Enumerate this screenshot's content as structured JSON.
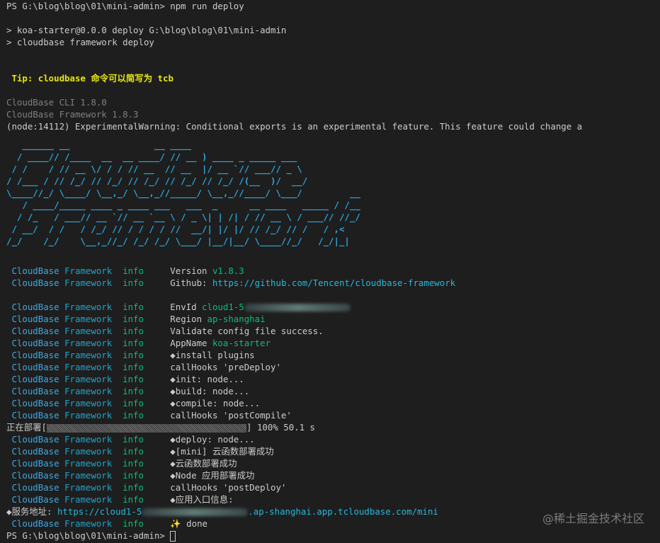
{
  "prompt": {
    "ps": "PS G:\\blog\\blog\\01\\mini-admin> ",
    "command": "npm run deploy"
  },
  "npm": {
    "line1": "> koa-starter@0.0.0 deploy G:\\blog\\blog\\01\\mini-admin",
    "line2": "> cloudbase framework deploy"
  },
  "tip": " Tip: cloudbase 命令可以简写为 tcb",
  "versions": {
    "cli": "CloudBase CLI 1.8.0",
    "framework": "CloudBase Framework 1.8.3"
  },
  "warning": "(node:14112) ExperimentalWarning: Conditional exports is an experimental feature. This feature could change a",
  "banner_lines": [
    "   ______ __                __ ____",
    "  / ____// /____  __  __ ____/ // __ ) ____ _ _____ ___",
    " / /    / // __ \\/ / / // __  // __  |/ __ `// ___// _ \\",
    "/ /___ / // /_/ // /_/ // /_/ // /_/ // /_/ /(__  )/  __/",
    "\\____//_/ \\____/ \\__,_/ \\__,_//_____/ \\__,_//____/ \\___/         __",
    "   / ____/_____ ____ _ ____ ___   ___  _      __ ____   _____ / /__",
    "  / /_   / ___// __ `// __ `__ \\ / _ \\| | /| / // __ \\ / ___// //_/",
    " / __/  / /   / /_/ // / / / / //  __/| |/ |/ // /_/ // /   / ,<",
    "/_/    /_/    \\__,_//_/ /_/ /_/ \\___/ |__/|__/ \\____//_/   /_/|_|"
  ],
  "brand": {
    "a": "CloudBase",
    "b": "Framework",
    "level": "info"
  },
  "logs": [
    {
      "label": "Version ",
      "value": "v1.8.3",
      "value_style": "g",
      "blur": 0
    },
    {
      "label": "Github: ",
      "value": "https://github.com/Tencent/cloudbase-framework",
      "value_style": "link",
      "blur": 0
    },
    null,
    {
      "label": "EnvId ",
      "value": "cloud1-5",
      "value_style": "g",
      "blur": 150
    },
    {
      "label": "Region ",
      "value": "ap-shanghai",
      "value_style": "g",
      "blur": 0
    },
    {
      "label": "Validate config file success.",
      "value": "",
      "value_style": "",
      "blur": 0
    },
    {
      "label": "AppName ",
      "value": "koa-starter",
      "value_style": "g",
      "blur": 0
    },
    {
      "label": "◆install plugins",
      "value": "",
      "value_style": "",
      "blur": 0
    },
    {
      "label": "callHooks 'preDeploy'",
      "value": "",
      "value_style": "",
      "blur": 0
    },
    {
      "label": "◆init: node...",
      "value": "",
      "value_style": "",
      "blur": 0
    },
    {
      "label": "◆build: node...",
      "value": "",
      "value_style": "",
      "blur": 0
    },
    {
      "label": "◆compile: node...",
      "value": "",
      "value_style": "",
      "blur": 0
    },
    {
      "label": "callHooks 'postCompile'",
      "value": "",
      "value_style": "",
      "blur": 0
    }
  ],
  "progress": {
    "label": "正在部署[",
    "suffix": "] 100% 50.1 s",
    "percent": 100
  },
  "logs2": [
    {
      "label": "◆deploy: node..."
    },
    {
      "label": "◆[mini] 云函数部署成功"
    },
    {
      "label": "◆云函数部署成功"
    },
    {
      "label": "◆Node 应用部署成功"
    },
    {
      "label": "callHooks 'postDeploy'"
    },
    {
      "label": "◆应用入口信息:"
    }
  ],
  "service": {
    "label": "◆服务地址: ",
    "url_start": "https://cloud1-5",
    "url_end": ".ap-shanghai.app.tcloudbase.com/mini"
  },
  "done": {
    "icon": "sparkles-icon",
    "glyph": "✨",
    "text": " done"
  },
  "final_prompt": "PS G:\\blog\\blog\\01\\mini-admin> ",
  "watermark": "@稀土掘金技术社区",
  "colors": {
    "background": "#1e1e1e",
    "foreground": "#cccccc",
    "green": "#0dbc79",
    "blue": "#3fa8e0",
    "tip": "#e5e510",
    "link": "#29b8db"
  }
}
